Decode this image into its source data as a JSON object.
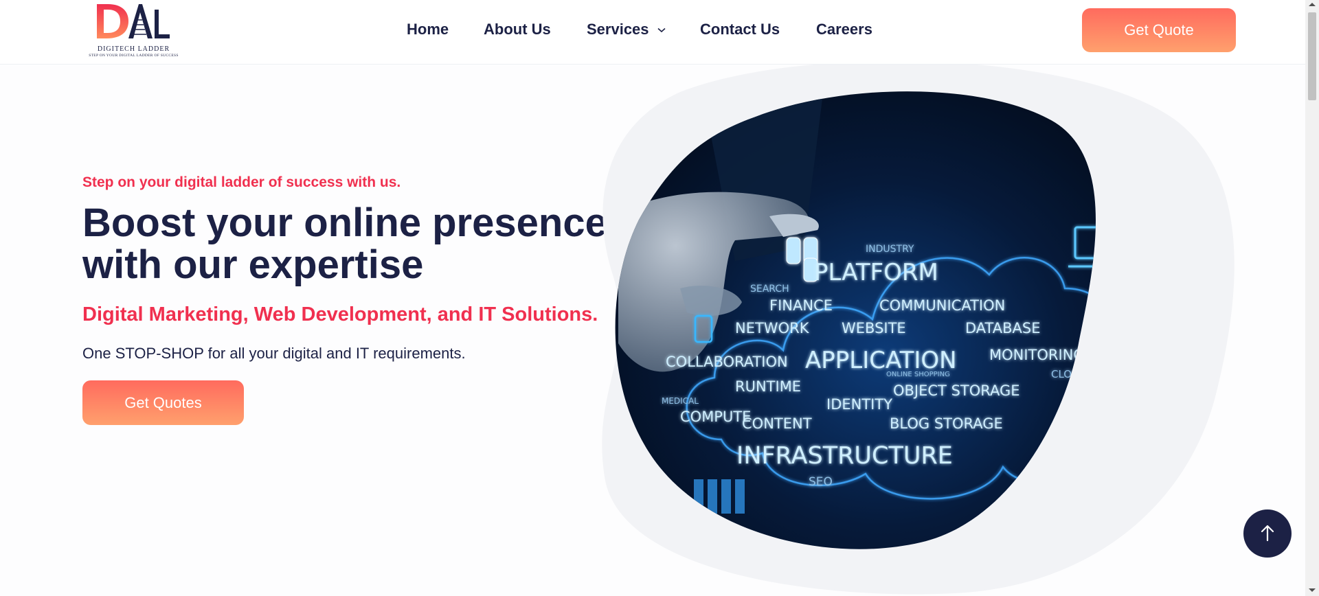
{
  "brand": {
    "name": "DIGITECH LADDER",
    "tagline": "STEP ON YOUR DIGITAL LADDER OF SUCCESS",
    "accent": "#f0304f",
    "navy": "#1c2145",
    "button_gradient": [
      "#ff6b5e",
      "#ffa06d"
    ]
  },
  "nav": {
    "items": [
      "Home",
      "About Us",
      "Services",
      "Contact Us",
      "Careers"
    ],
    "cta": "Get Quote"
  },
  "hero": {
    "tagline": "Step on your digital ladder of success with us.",
    "headline_line1": "Boost your online presence",
    "headline_line2": "with our expertise",
    "subheadline": "Digital Marketing, Web Development, and IT Solutions.",
    "description": "One STOP-SHOP for all your digital and IT requirements.",
    "cta": "Get Quotes"
  },
  "cloud_words": {
    "industry": "INDUSTRY",
    "platform": "PLATFORM",
    "search": "SEARCH",
    "finance": "FINANCE",
    "communication": "COMMUNICATION",
    "network": "NETWORK",
    "website": "WEBSITE",
    "database": "DATABASE",
    "collaboration": "COLLABORATION",
    "application": "APPLICATION",
    "monitoring": "MONITORING",
    "online_shopping": "ONLINE SHOPPING",
    "cloud": "CLOUD",
    "runtime": "RUNTIME",
    "object_storage": "OBJECT STORAGE",
    "medical": "MEDICAL",
    "identity": "IDENTITY",
    "compute": "COMPUTE",
    "content": "CONTENT",
    "blog_storage": "BLOG STORAGE",
    "infrastructure": "INFRASTRUCTURE",
    "seo": "SEO"
  },
  "icons": {
    "scroll_top": "arrow-up-icon",
    "services_dropdown": "chevron-down-icon"
  }
}
